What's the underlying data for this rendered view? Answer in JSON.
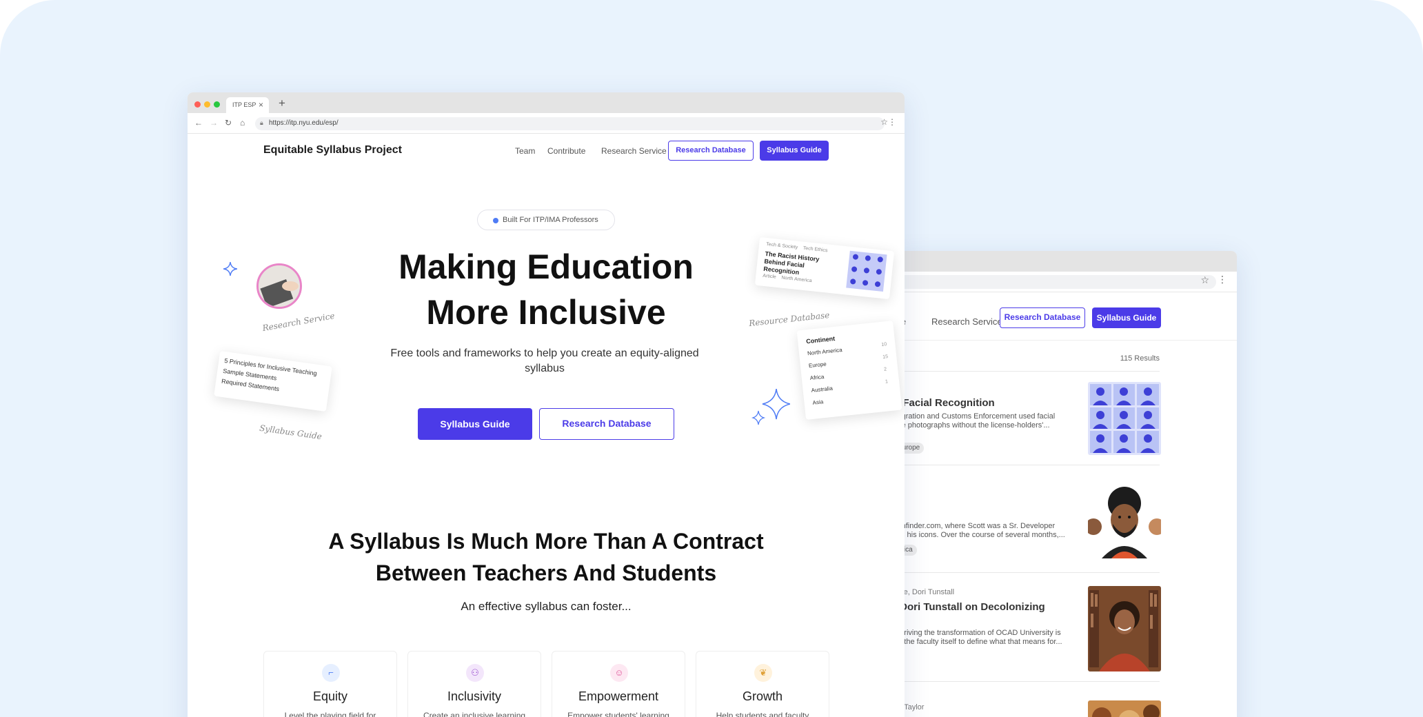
{
  "front": {
    "tab_title": "ITP ESP",
    "url": "https://itp.nyu.edu/esp/",
    "brand": "Equitable Syllabus Project",
    "nav": [
      "Team",
      "Contribute",
      "Research Service"
    ],
    "nav_outline_btn": "Research Database",
    "nav_solid_btn": "Syllabus Guide",
    "pill": "Built For ITP/IMA Professors",
    "hero_line1": "Making Education",
    "hero_line2": "More Inclusive",
    "subtitle": "Free tools and frameworks to help you create an equity-aligned syllabus",
    "cta_primary": "Syllabus Guide",
    "cta_secondary": "Research Database",
    "deco": {
      "research_service": "Research Service",
      "syllabus_guide": "Syllabus Guide",
      "research_database": "Resource Database",
      "list_items": [
        "5 Principles for Inclusive Teaching",
        "Sample Statements",
        "Required Statements"
      ],
      "article_meta": "Tech & Society    Tech Ethics",
      "article_title": "The Racist History Behind Facial Recognition",
      "article_foot": "Article    North America",
      "filter_title": "Continent",
      "filter_items": [
        "North America",
        "Europe",
        "Africa",
        "Australia",
        "Asia"
      ],
      "filter_counts": [
        "10",
        "15",
        "2",
        "1",
        ""
      ]
    },
    "section_title_line1": "A Syllabus Is Much More Than A Contract",
    "section_title_line2": "Between Teachers And Students",
    "section_sub": "An effective syllabus can foster...",
    "features": [
      {
        "title": "Equity",
        "desc": "Level the playing field for",
        "icon": "stairs-icon",
        "color": "#e6efff",
        "ico_color": "#4f7cf5"
      },
      {
        "title": "Inclusivity",
        "desc": "Create an inclusive learning",
        "icon": "people-icon",
        "color": "#f3e6fb",
        "ico_color": "#9b4fd0"
      },
      {
        "title": "Empowerment",
        "desc": "Empower students' learning",
        "icon": "smile-icon",
        "color": "#fde8f2",
        "ico_color": "#e0559a"
      },
      {
        "title": "Growth",
        "desc": "Help students and faculty",
        "icon": "sprout-icon",
        "color": "#fff2dc",
        "ico_color": "#e0a23a"
      }
    ]
  },
  "back": {
    "nav_partial": "ute",
    "nav_research_service": "Research Service",
    "nav_outline_btn": "Research Database",
    "nav_solid_btn": "Syllabus Guide",
    "results": "115 Results",
    "items": [
      {
        "title": "d Facial Recognition",
        "line1": "migration and Customs Enforcement used facial",
        "line2": "nse photographs without the license-holders'...",
        "tag": "Europe"
      },
      {
        "meta": "s",
        "line1": "confinder.com, where Scott was a Sr. Developer",
        "line2": "ells his icons. Over the course of several months,...",
        "tag": "erica"
      },
      {
        "meta": "cute, Dori Tunstall",
        "title": ": Dori Tunstall on Decolonizing",
        "line1": "e driving the transformation of OCAD University is",
        "line2": "ng the faculty itself to define what that means for..."
      },
      {
        "meta": "na Taylor"
      }
    ]
  }
}
